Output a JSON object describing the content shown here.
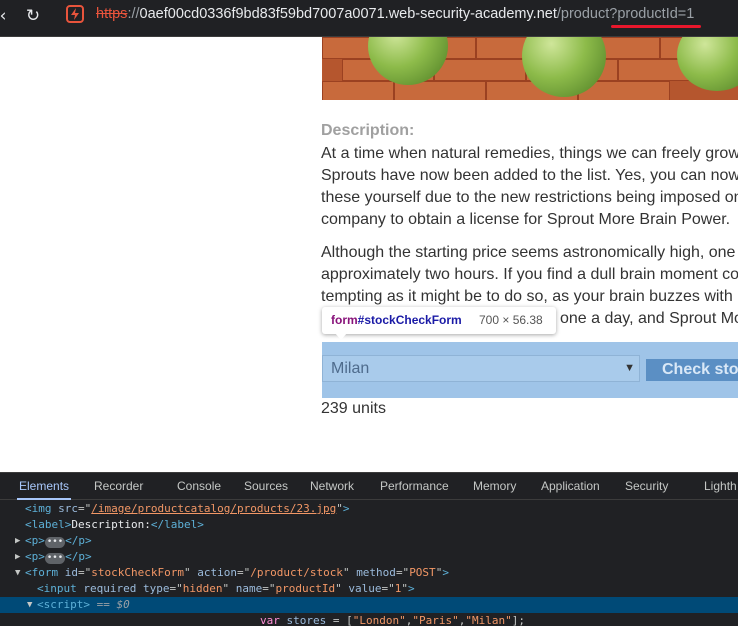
{
  "browser": {
    "url_scheme": "https",
    "url_sep": "://",
    "url_host": "0aef00cd0336f9bd83f59bd7007a0071.web-security-academy.net",
    "url_path": "/product?",
    "url_query": "productId=1",
    "reload_icon": "reload-icon",
    "site_icon": "lightning-icon",
    "annotation_color": "#e8172c"
  },
  "page": {
    "description_title": "Description:",
    "paragraphs": [
      "At a time when natural remedies, things we can freely grow",
      "Sprouts have now been added to the list. Yes, you can now",
      "these yourself due to the new restrictions being imposed on",
      "company to obtain a license for Sprout More Brain Power.",
      "Although the starting price seems astronomically high, one",
      "approximately two hours. If you find a dull brain moment co",
      "tempting as it might be to do so, as your brain buzzes with",
      "one a day, and Sprout Mo"
    ],
    "store_select_value": "Milan",
    "check_stock_label": "Check sto",
    "stock_result": "239 units",
    "tooltip": {
      "tag": "form",
      "id": "#stockCheckForm",
      "dims": "700 × 56.38"
    }
  },
  "devtools": {
    "tabs": [
      "Elements",
      "Recorder",
      "Console",
      "Sources",
      "Network",
      "Performance",
      "Memory",
      "Application",
      "Security",
      "Lighth"
    ],
    "active_tab": "Elements",
    "dom": {
      "img_src": "/image/productcatalog/products/23.jpg",
      "label_text": "Description:",
      "form_id": "stockCheckForm",
      "form_action": "/product/stock",
      "form_method": "POST",
      "input_type": "hidden",
      "input_name": "productId",
      "input_value": "1",
      "selected_marker": "== $0",
      "stores": [
        "London",
        "Paris",
        "Milan"
      ]
    }
  }
}
